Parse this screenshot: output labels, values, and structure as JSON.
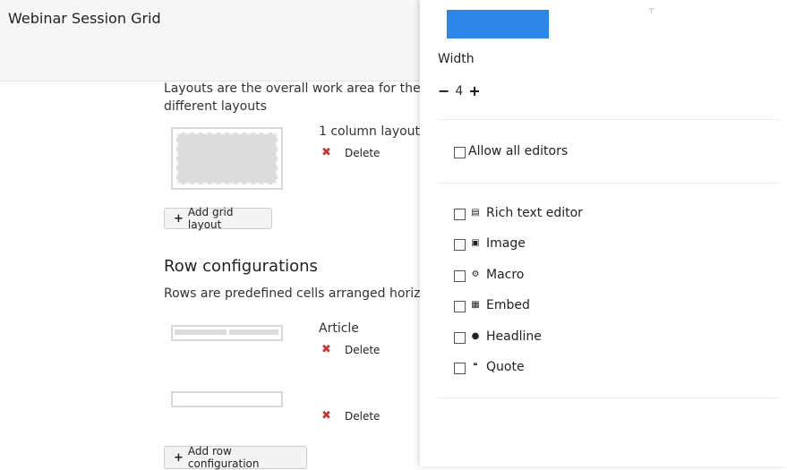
{
  "header": {
    "title": "Webinar Session Grid"
  },
  "layouts": {
    "intro_line1": "Layouts are the overall work area for the gri",
    "intro_line2": "different layouts",
    "items": [
      {
        "label": "1 column layout",
        "delete_label": "Delete"
      }
    ],
    "add_button_label": "Add grid layout"
  },
  "rows": {
    "title": "Row configurations",
    "intro": "Rows are predefined cells arranged horizont",
    "items": [
      {
        "label": "Article",
        "delete_label": "Delete"
      },
      {
        "label": "",
        "delete_label": "Delete"
      }
    ],
    "add_button_label": "Add row configuration"
  },
  "panel": {
    "accent_color": "#2e86e6",
    "width_label": "Width",
    "width_value": "4",
    "allow_all_label": "Allow all editors",
    "editors": [
      {
        "label": "Rich text editor",
        "icon": "rich-text-icon"
      },
      {
        "label": "Image",
        "icon": "image-icon"
      },
      {
        "label": "Macro",
        "icon": "macro-icon"
      },
      {
        "label": "Embed",
        "icon": "embed-icon"
      },
      {
        "label": "Headline",
        "icon": "headline-icon"
      },
      {
        "label": "Quote",
        "icon": "quote-icon"
      }
    ]
  }
}
